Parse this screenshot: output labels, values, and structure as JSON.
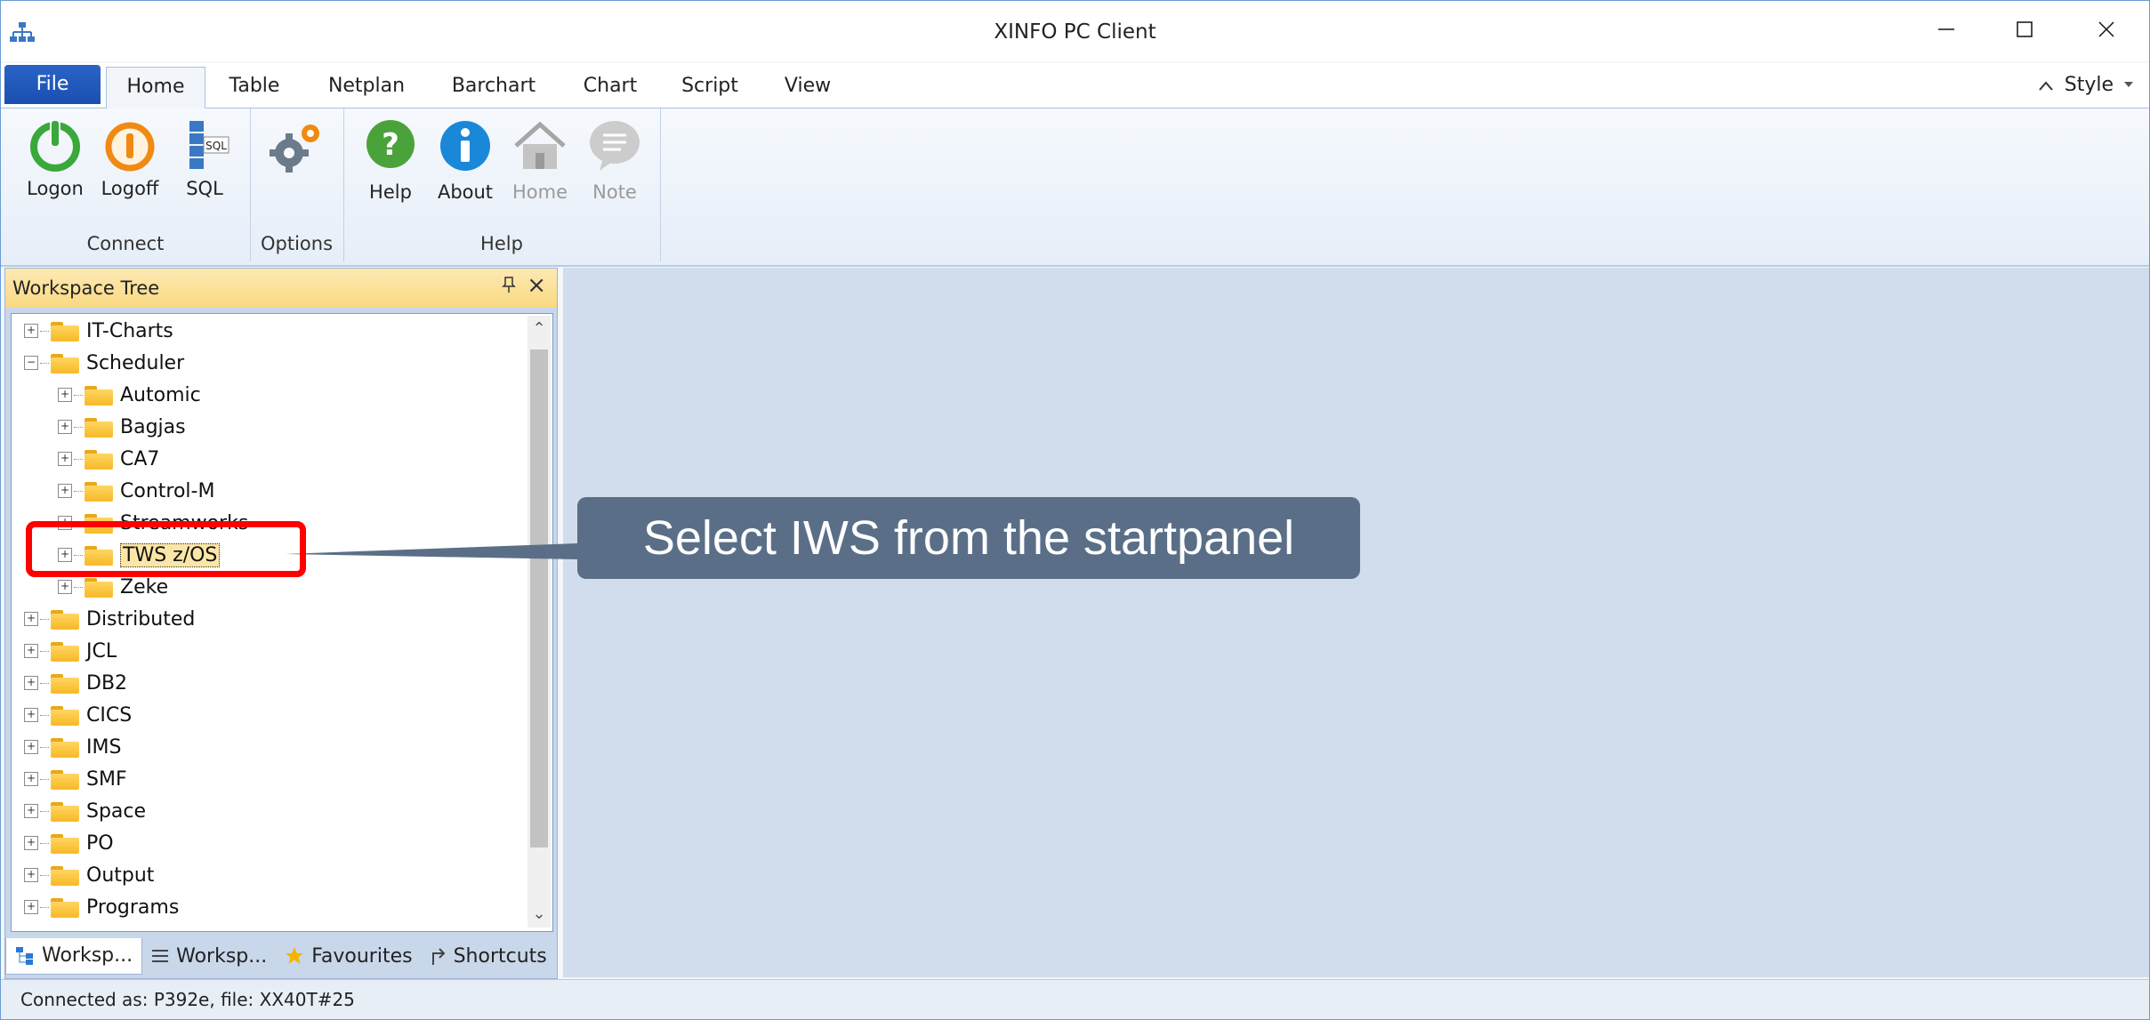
{
  "window": {
    "title": "XINFO PC Client"
  },
  "ribbon_tabs": [
    "File",
    "Home",
    "Table",
    "Netplan",
    "Barchart",
    "Chart",
    "Script",
    "View"
  ],
  "style_label": "Style",
  "ribbon": {
    "buttons": [
      {
        "label": "Logon",
        "icon": "power-icon"
      },
      {
        "label": "Logoff",
        "icon": "logoff-icon"
      },
      {
        "label": "SQL",
        "icon": "sql-icon"
      },
      {
        "label": "",
        "icon": "gear-icon"
      },
      {
        "label": "Help",
        "icon": "help-icon"
      },
      {
        "label": "About",
        "icon": "info-icon"
      },
      {
        "label": "Home",
        "icon": "home-icon"
      },
      {
        "label": "Note",
        "icon": "note-icon"
      }
    ],
    "groups": [
      "Connect",
      "Options",
      "Help"
    ]
  },
  "workspace": {
    "title": "Workspace Tree",
    "tree": [
      {
        "label": "IT-Charts"
      },
      {
        "label": "Scheduler"
      },
      {
        "label": "Automic"
      },
      {
        "label": "Bagjas"
      },
      {
        "label": "CA7"
      },
      {
        "label": "Control-M"
      },
      {
        "label": "Streamworks"
      },
      {
        "label": "TWS z/OS"
      },
      {
        "label": "Zeke"
      },
      {
        "label": "Distributed"
      },
      {
        "label": "JCL"
      },
      {
        "label": "DB2"
      },
      {
        "label": "CICS"
      },
      {
        "label": "IMS"
      },
      {
        "label": "SMF"
      },
      {
        "label": "Space"
      },
      {
        "label": "PO"
      },
      {
        "label": "Output"
      },
      {
        "label": "Programs"
      }
    ],
    "tabs": [
      "Worksp...",
      "Worksp...",
      "Favourites",
      "Shortcuts"
    ]
  },
  "status": "Connected as: P392e, file: XX40T#25",
  "callout": "Select IWS from the startpanel",
  "colors": {
    "accent": "#1a4fb0",
    "panel_header": "#f9d982",
    "callout_bg": "#5a6f87",
    "highlight": "#ff0000"
  }
}
